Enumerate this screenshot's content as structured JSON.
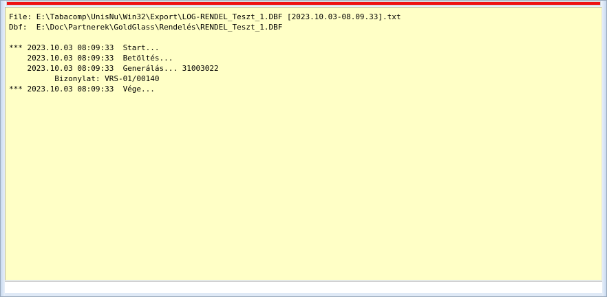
{
  "progress": {
    "fraction": 1.0,
    "color": "#ee1111"
  },
  "log": {
    "background": "#ffffc6",
    "lines": [
      "File: E:\\Tabacomp\\UnisNu\\Win32\\Export\\LOG-RENDEL_Teszt_1.DBF [2023.10.03-08.09.33].txt",
      "Dbf:  E:\\Doc\\Partnerek\\GoldGlass\\Rendelés\\RENDEL_Teszt_1.DBF",
      "",
      "*** 2023.10.03 08:09:33  Start...",
      "    2023.10.03 08:09:33  Betöltés...",
      "    2023.10.03 08:09:33  Generálás... 31003022",
      "          Bizonylat: VRS-01/00140",
      "*** 2023.10.03 08:09:33  Vége..."
    ]
  }
}
